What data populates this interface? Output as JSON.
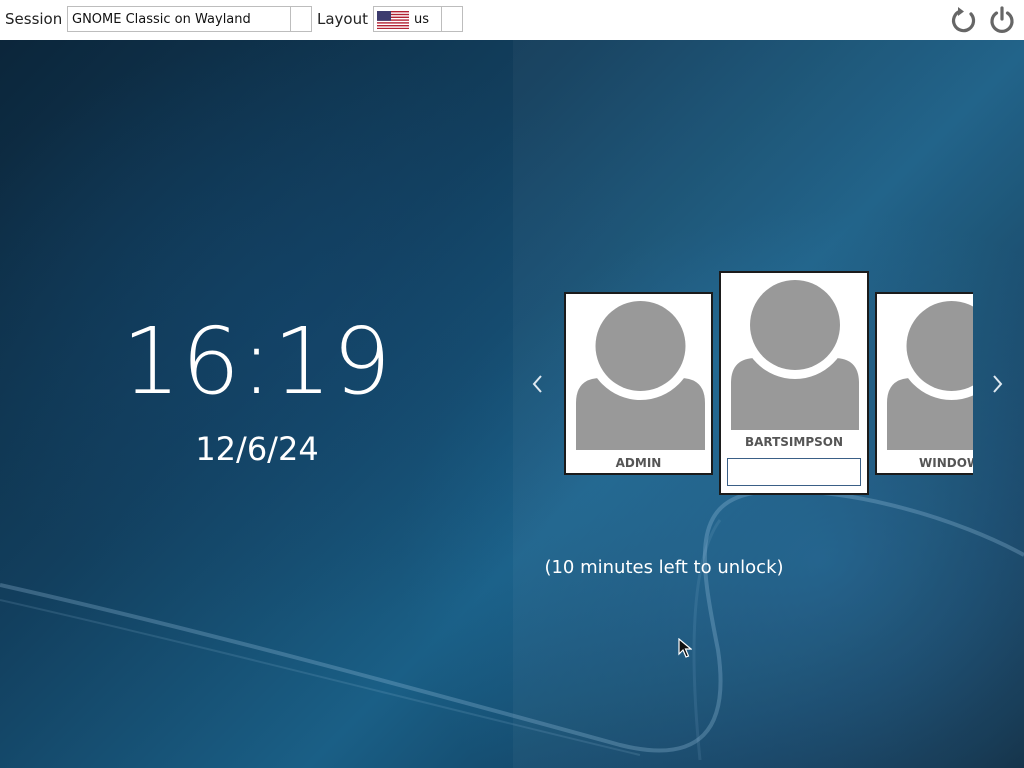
{
  "topbar": {
    "session_label": "Session",
    "session_value": "GNOME Classic on Wayland",
    "layout_label": "Layout",
    "layout_value": "us",
    "layout_flag": "us-flag-icon",
    "restart_icon": "restart-icon",
    "power_icon": "power-icon"
  },
  "clock": {
    "time": "16:19",
    "date": "12/6/24"
  },
  "users": [
    {
      "name": "ADMIN"
    },
    {
      "name": "BARTSIMPSON",
      "selected": true,
      "password": ""
    },
    {
      "name": "WINDOW"
    }
  ],
  "navigation": {
    "prev_icon": "chevron-left-icon",
    "next_icon": "chevron-right-icon"
  },
  "lock_notice": "(10 minutes left to unlock)",
  "colors": {
    "background": "#123f5e",
    "avatar": "#999999",
    "password_border": "#3a5f86"
  }
}
